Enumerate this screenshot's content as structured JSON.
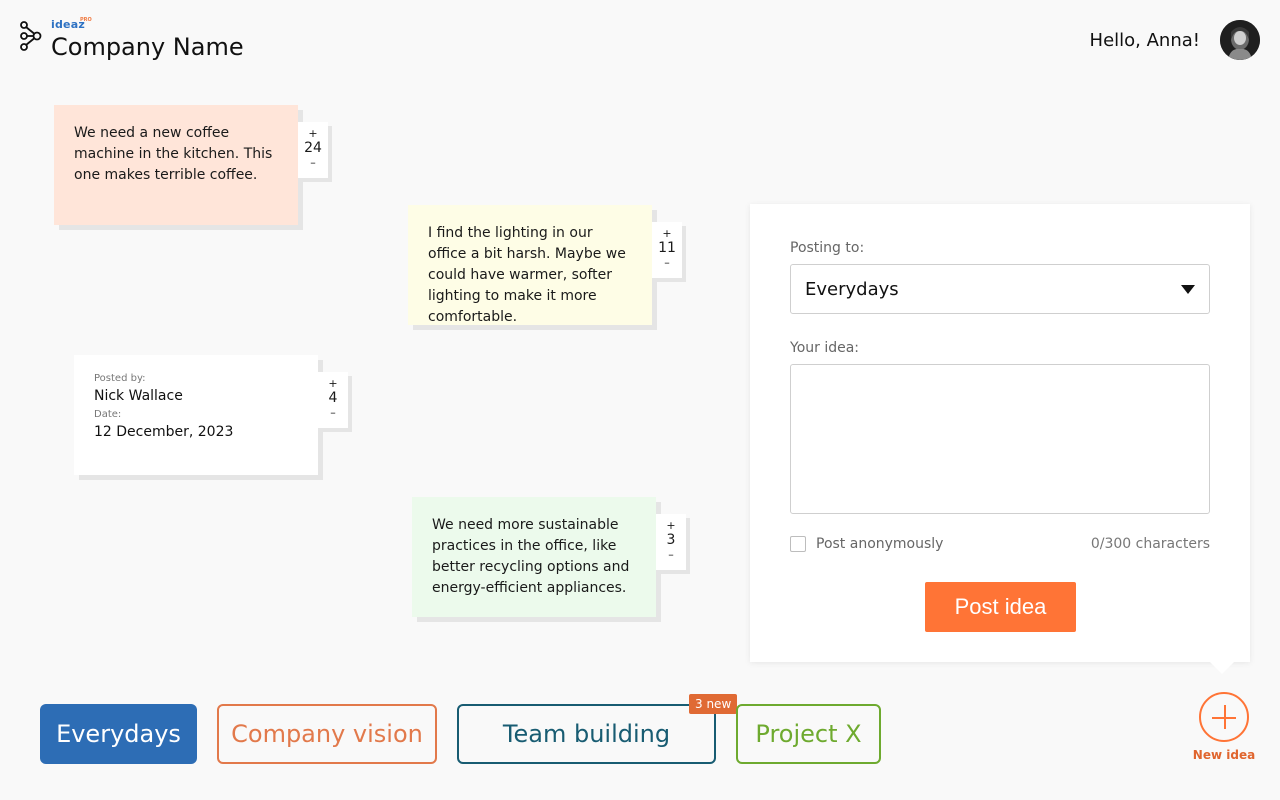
{
  "header": {
    "brand_small": "ideaz",
    "brand_pro": "PRO",
    "company_name": "Company Name",
    "greeting": "Hello, Anna!"
  },
  "notes": [
    {
      "text": "We need a new coffee machine in the kitchen. This one makes terrible coffee.",
      "votes": "24",
      "color": "#ffe5d9"
    },
    {
      "text": "I find the lighting in our office a bit harsh. Maybe we could have warmer, softer lighting to make it more comfortable.",
      "votes": "11",
      "color": "#fefde6"
    },
    {
      "posted_by_label": "Posted by:",
      "posted_by": "Nick Wallace",
      "date_label": "Date:",
      "date": "12 December, 2023",
      "votes": "4",
      "color": "#ffffff"
    },
    {
      "text": "We need more sustainable practices in the office, like better recycling options and energy-efficient appliances.",
      "votes": "3",
      "color": "#ecfaec"
    }
  ],
  "vote_plus": "+",
  "vote_minus": "–",
  "panel": {
    "posting_to_label": "Posting to:",
    "posting_to_value": "Everydays",
    "your_idea_label": "Your idea:",
    "idea_value": "",
    "anonymous_label": "Post anonymously",
    "char_count": "0/300 characters",
    "post_button": "Post idea"
  },
  "tabs": [
    {
      "label": "Everydays",
      "active": true,
      "color": "#2d6db5"
    },
    {
      "label": "Company vision",
      "color": "#e2794b"
    },
    {
      "label": "Team building",
      "color": "#185c72",
      "badge": "3 new"
    },
    {
      "label": "Project X",
      "color": "#6eaa2f"
    }
  ],
  "new_idea_label": "New idea",
  "accent_color": "#ff7436"
}
